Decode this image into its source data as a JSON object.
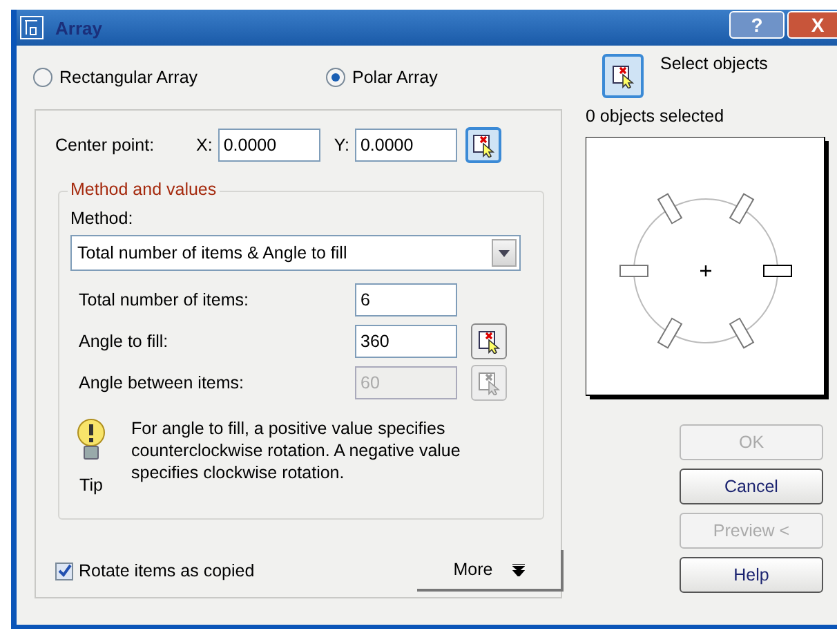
{
  "window": {
    "title": "Array",
    "help_button": "?",
    "close_button": "X"
  },
  "array_types": [
    {
      "label": "Rectangular Array",
      "selected": false
    },
    {
      "label": "Polar Array",
      "selected": true
    }
  ],
  "center_point": {
    "label": "Center point:",
    "x_label": "X:",
    "x_value": "0.0000",
    "y_label": "Y:",
    "y_value": "0.0000"
  },
  "method_group": {
    "title": "Method and values",
    "method_label": "Method:",
    "method_value": "Total number of items & Angle to fill",
    "fields": [
      {
        "label": "Total number of items:",
        "value": "6",
        "disabled": false,
        "kind": "plain"
      },
      {
        "label": "Angle to fill:",
        "value": "360",
        "disabled": false,
        "kind": "pick"
      },
      {
        "label": "Angle between items:",
        "value": "60",
        "disabled": true,
        "kind": "pick"
      }
    ]
  },
  "tip": {
    "text": "For angle to fill, a positive value specifies counterclockwise rotation.  A negative value specifies clockwise rotation.",
    "label": "Tip"
  },
  "rotate_items": {
    "label": "Rotate items as copied",
    "checked": true
  },
  "more_button": {
    "label": "More"
  },
  "select_objects": {
    "label": "Select objects",
    "status": "0 objects selected"
  },
  "buttons": [
    {
      "label": "OK",
      "disabled": true
    },
    {
      "label": "Cancel",
      "disabled": false
    },
    {
      "label": "Preview <",
      "disabled": true
    },
    {
      "label": "Help",
      "disabled": false
    }
  ]
}
